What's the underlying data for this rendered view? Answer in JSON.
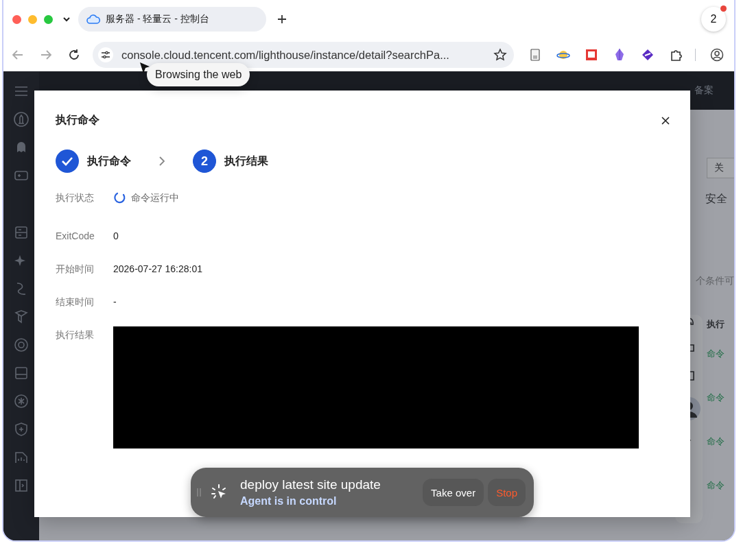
{
  "browser": {
    "tabs": [
      {
        "title": "服务器 - 轻量云 - 控制台",
        "selected": true
      }
    ],
    "notification_count": "2",
    "address": "console.cloud.tencent.com/lighthouse/instance/detail?searchPa...",
    "tooltip": "Browsing the web"
  },
  "console": {
    "header_links": [
      "备案"
    ],
    "right_panel": {
      "button": "关",
      "tab": "安全",
      "hint": "个条件可",
      "column_header": "执行",
      "statuses": [
        "命令",
        "命令",
        "命令",
        "命令"
      ]
    }
  },
  "dialog": {
    "title": "执行命令",
    "steps": [
      {
        "label": "执行命令",
        "completed": true
      },
      {
        "number": "2",
        "label": "执行结果",
        "completed": false
      }
    ],
    "fields": [
      {
        "label": "执行状态",
        "value": "命令运行中",
        "kind": "running"
      },
      {
        "label": "ExitCode",
        "value": "0",
        "kind": "text"
      },
      {
        "label": "开始时间",
        "value": "2026-07-27 16:28:01",
        "kind": "text"
      },
      {
        "label": "结束时间",
        "value": "-",
        "kind": "text"
      },
      {
        "label": "执行结果",
        "kind": "output"
      }
    ]
  },
  "agent_bar": {
    "task": "deploy latest site update",
    "status": "Agent is in control",
    "buttons": [
      {
        "label": "Take over",
        "kind": "neutral"
      },
      {
        "label": "Stop",
        "kind": "danger"
      }
    ]
  }
}
